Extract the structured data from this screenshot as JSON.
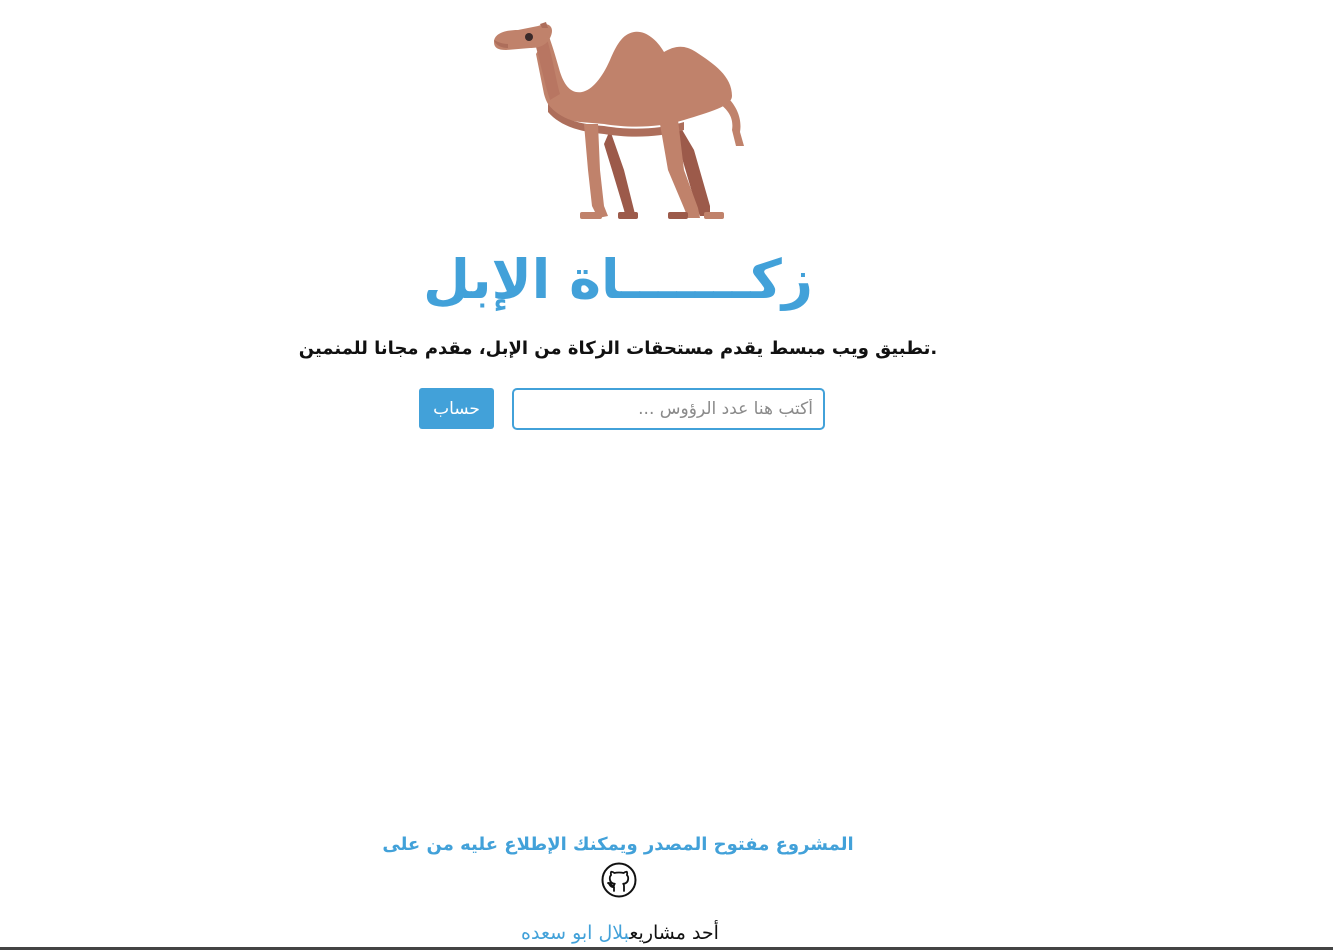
{
  "header": {
    "logo_icon": "camel-icon",
    "title": "زكـــــــاة الإبل",
    "subtitle": ".تطبيق ويب مبسط يقدم مستحقات الزكاة من الإبل، مقدم مجانا للمنمين"
  },
  "form": {
    "input_placeholder": "أكتب هنا عدد الرؤوس ...",
    "input_value": "",
    "button_label": "حساب"
  },
  "footer": {
    "open_source_note": "المشروع مفتوح المصدر ويمكنك الإطلاع عليه من على",
    "github_icon": "github-icon",
    "credit_prefix": "أحد مشاريع",
    "author_name": "بلال ابو سعده"
  },
  "colors": {
    "accent": "#42a1d9",
    "camel_body": "#c0826b",
    "camel_shadow": "#9c5a4a"
  }
}
